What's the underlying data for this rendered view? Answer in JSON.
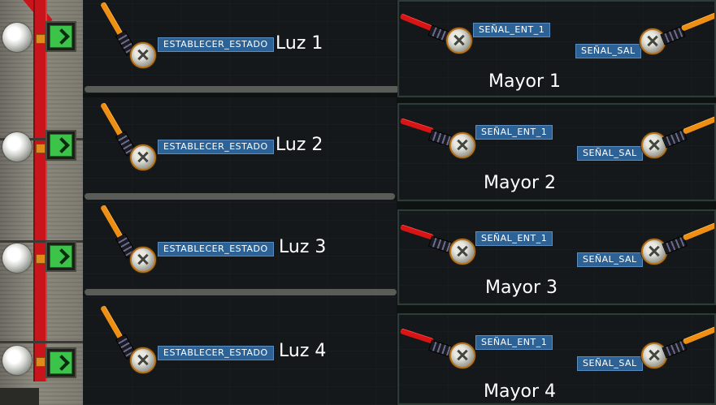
{
  "colors": {
    "wire_input": "#d81414",
    "wire_output": "#ee8f13",
    "tag_bg": "#2d6296",
    "indicator_green": "#3cc44a"
  },
  "lights": [
    {
      "title": "Luz 1",
      "input_label": "ESTABLECER_ESTADO"
    },
    {
      "title": "Luz 2",
      "input_label": "ESTABLECER_ESTADO"
    },
    {
      "title": "Luz 3",
      "input_label": "ESTABLECER_ESTADO"
    },
    {
      "title": "Luz 4",
      "input_label": "ESTABLECER_ESTADO"
    }
  ],
  "comparators": [
    {
      "title": "Mayor 1",
      "input_label": "SEÑAL_ENT_1",
      "output_label": "SEÑAL_SAL"
    },
    {
      "title": "Mayor 2",
      "input_label": "SEÑAL_ENT_1",
      "output_label": "SEÑAL_SAL"
    },
    {
      "title": "Mayor 3",
      "input_label": "SEÑAL_ENT_1",
      "output_label": "SEÑAL_SAL"
    },
    {
      "title": "Mayor 4",
      "input_label": "SEÑAL_ENT_1",
      "output_label": "SEÑAL_SAL"
    }
  ]
}
